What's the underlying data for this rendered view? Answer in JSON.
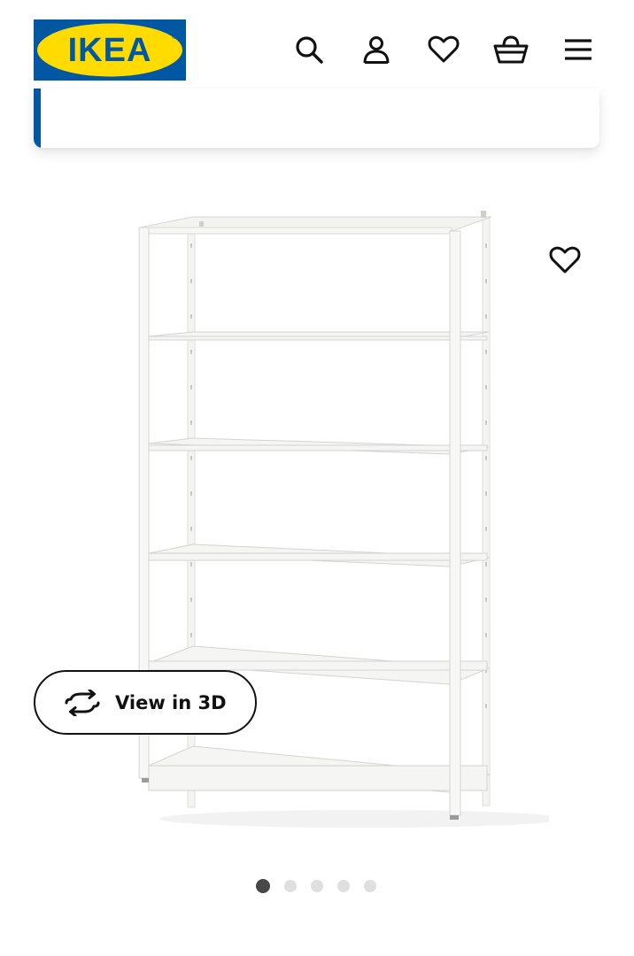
{
  "brand": {
    "logo_text": "IKEA",
    "registered_mark": "®",
    "colors": {
      "blue": "#0058a3",
      "yellow": "#ffdb00"
    }
  },
  "header": {
    "icons": [
      "search-icon",
      "account-icon",
      "favourites-icon",
      "basket-icon",
      "menu-icon"
    ]
  },
  "notice": {
    "text": "",
    "accent_color": "#0058a3"
  },
  "product": {
    "favourite_icon": "heart-outline-icon",
    "view_3d_label": "View in 3D",
    "view_3d_icon": "rotate-icon"
  },
  "carousel": {
    "total": 5,
    "active_index": 0
  }
}
